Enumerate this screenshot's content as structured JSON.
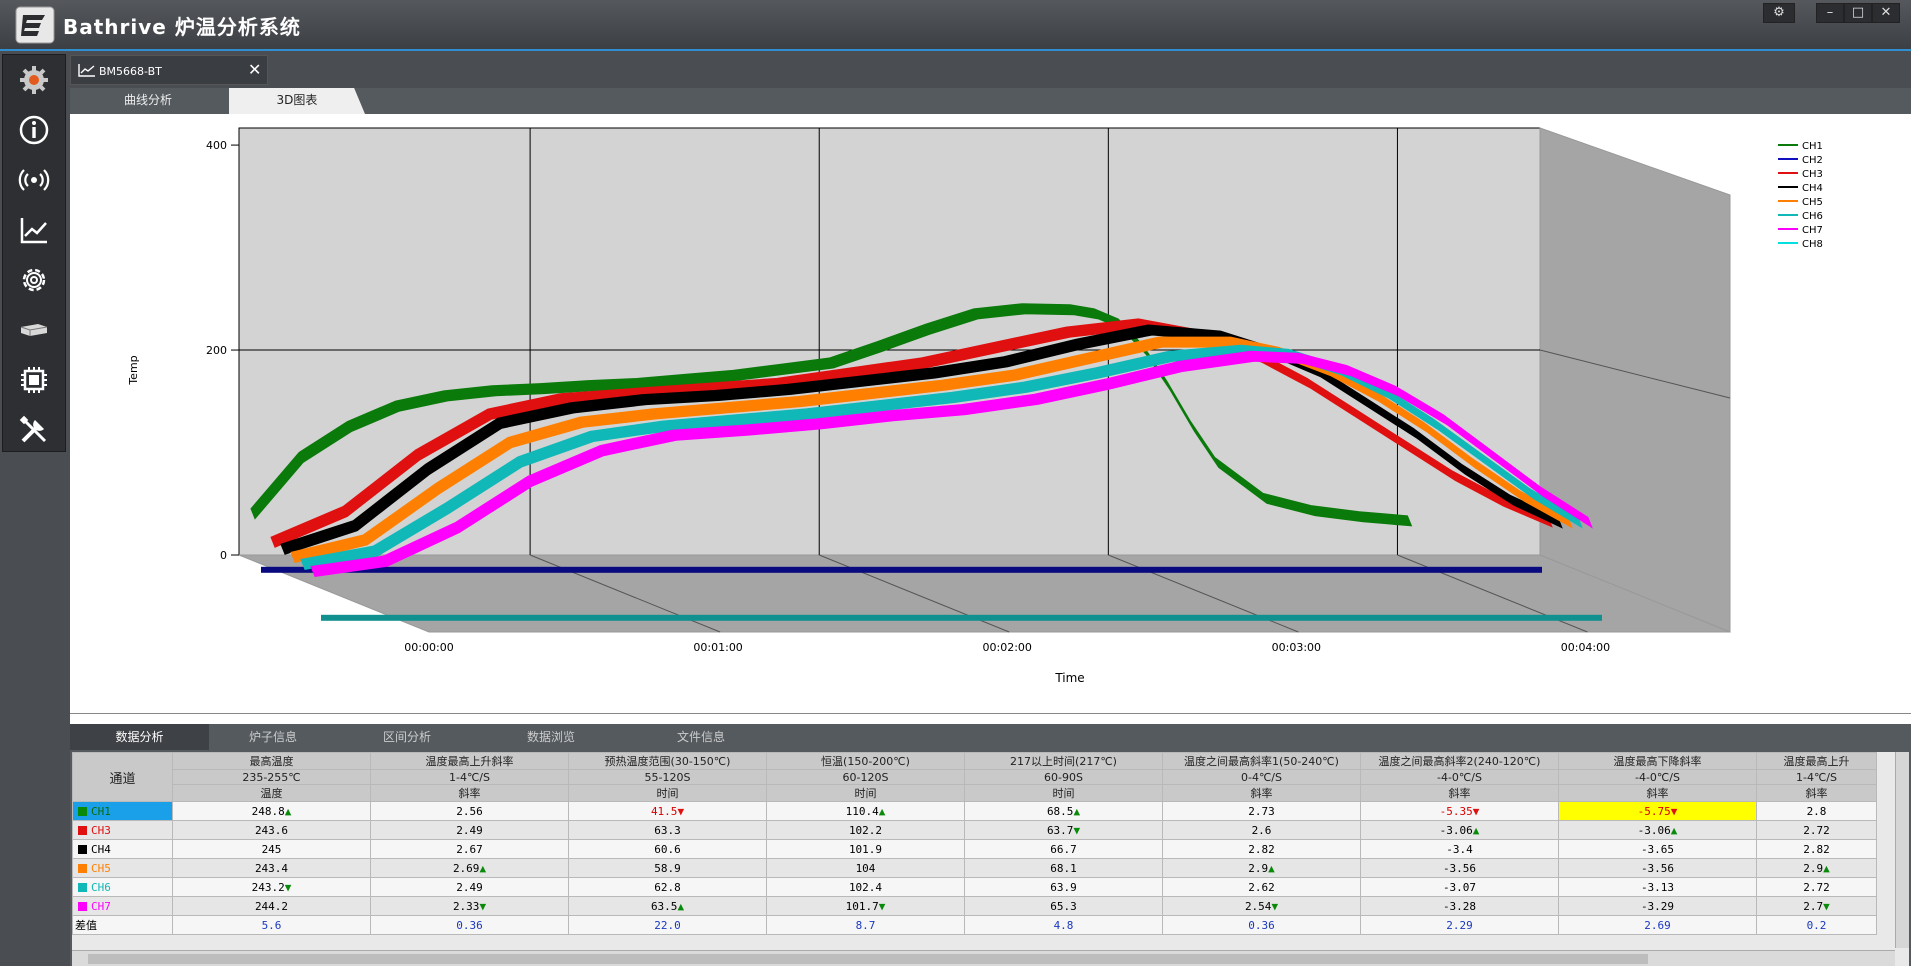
{
  "app": {
    "title": "Bathrive 炉温分析系统"
  },
  "window_controls": {
    "settings": "⚙",
    "minimize": "–",
    "maximize": "□",
    "close": "✕"
  },
  "sidebar": {
    "items": [
      {
        "name": "gear-logo-icon"
      },
      {
        "name": "info-icon"
      },
      {
        "name": "wireless-icon"
      },
      {
        "name": "line-chart-icon"
      },
      {
        "name": "settings-icon"
      },
      {
        "name": "device-icon"
      },
      {
        "name": "chip-icon"
      },
      {
        "name": "tools-icon"
      }
    ]
  },
  "doc_tab": {
    "label": "BM5668-BT",
    "close": "✕"
  },
  "view_tabs": {
    "curve": "曲线分析",
    "three_d": "3D图表"
  },
  "chart_data": {
    "type": "line",
    "style": "3d-ribbon",
    "ylabel": "Temp",
    "xlabel": "Time",
    "y_ticks": [
      "0",
      "200",
      "400"
    ],
    "ylim": [
      0,
      400
    ],
    "x_ticks": [
      "00:00:00",
      "00:01:00",
      "00:02:00",
      "00:03:00",
      "00:04:00"
    ],
    "xlim_seconds": [
      0,
      270
    ],
    "legend": [
      "CH1",
      "CH2",
      "CH3",
      "CH4",
      "CH5",
      "CH6",
      "CH7",
      "CH8"
    ],
    "legend_position": "top-right",
    "series": [
      {
        "name": "CH1",
        "color": "#0a7a0a",
        "x": [
          0,
          10,
          20,
          30,
          40,
          50,
          60,
          70,
          80,
          90,
          100,
          110,
          120,
          130,
          140,
          150,
          160,
          170,
          175,
          180,
          185,
          190,
          195,
          200,
          210,
          220,
          230,
          235,
          240
        ],
        "y": [
          45,
          100,
          130,
          150,
          160,
          165,
          167,
          170,
          172,
          176,
          180,
          186,
          192,
          208,
          225,
          240,
          245,
          244,
          240,
          230,
          205,
          170,
          130,
          95,
          60,
          48,
          42,
          40,
          38
        ]
      },
      {
        "name": "CH2",
        "color": "#1010c0",
        "x": [
          0,
          270
        ],
        "y": [
          0,
          0
        ]
      },
      {
        "name": "CH3",
        "color": "#e01010",
        "x": [
          0,
          15,
          30,
          45,
          60,
          75,
          90,
          105,
          120,
          135,
          150,
          165,
          180,
          195,
          205,
          215,
          225,
          235,
          245,
          255,
          265
        ],
        "y": [
          25,
          55,
          110,
          150,
          165,
          170,
          175,
          180,
          190,
          200,
          215,
          230,
          238,
          225,
          205,
          180,
          150,
          120,
          90,
          65,
          45
        ]
      },
      {
        "name": "CH4",
        "color": "#000000",
        "x": [
          0,
          15,
          30,
          45,
          60,
          75,
          90,
          105,
          120,
          135,
          150,
          165,
          180,
          195,
          205,
          215,
          225,
          235,
          245,
          255,
          265
        ],
        "y": [
          22,
          45,
          100,
          145,
          160,
          168,
          172,
          178,
          186,
          194,
          205,
          222,
          236,
          230,
          215,
          195,
          165,
          135,
          100,
          70,
          48
        ]
      },
      {
        "name": "CH5",
        "color": "#ff8000",
        "x": [
          0,
          15,
          30,
          45,
          60,
          75,
          90,
          105,
          120,
          135,
          150,
          165,
          180,
          195,
          205,
          215,
          225,
          235,
          245,
          255,
          265
        ],
        "y": [
          18,
          35,
          85,
          130,
          150,
          158,
          164,
          170,
          178,
          186,
          196,
          212,
          228,
          228,
          218,
          200,
          175,
          145,
          110,
          78,
          52
        ]
      },
      {
        "name": "CH6",
        "color": "#10b8b8",
        "x": [
          0,
          15,
          30,
          45,
          60,
          75,
          90,
          105,
          120,
          135,
          150,
          165,
          180,
          195,
          205,
          215,
          225,
          235,
          245,
          255,
          265
        ],
        "y": [
          15,
          28,
          70,
          115,
          140,
          150,
          156,
          162,
          170,
          178,
          188,
          202,
          218,
          224,
          220,
          205,
          182,
          152,
          118,
          84,
          56
        ]
      },
      {
        "name": "CH7",
        "color": "#ff00ff",
        "x": [
          0,
          15,
          30,
          45,
          60,
          75,
          90,
          105,
          120,
          135,
          150,
          165,
          180,
          195,
          205,
          215,
          225,
          235,
          245,
          255,
          265
        ],
        "y": [
          12,
          22,
          55,
          100,
          130,
          145,
          150,
          156,
          164,
          170,
          180,
          195,
          212,
          222,
          220,
          208,
          188,
          160,
          125,
          90,
          60
        ]
      },
      {
        "name": "CH8",
        "color": "#00e0e0",
        "x": [
          0,
          270
        ],
        "y": [
          0,
          0
        ]
      }
    ]
  },
  "bottom_tabs": [
    "数据分析",
    "炉子信息",
    "区间分析",
    "数据浏览",
    "文件信息"
  ],
  "table": {
    "channel_header": "通道",
    "columns": [
      {
        "title": "最高温度",
        "range": "235-255℃",
        "unit": "温度"
      },
      {
        "title": "温度最高上升斜率",
        "range": "1-4℃/S",
        "unit": "斜率"
      },
      {
        "title": "预热温度范围(30-150℃)",
        "range": "55-120S",
        "unit": "时间"
      },
      {
        "title": "恒温(150-200℃)",
        "range": "60-120S",
        "unit": "时间"
      },
      {
        "title": "217以上时间(217℃)",
        "range": "60-90S",
        "unit": "时间"
      },
      {
        "title": "温度之间最高斜率1(50-240℃)",
        "range": "0-4℃/S",
        "unit": "斜率"
      },
      {
        "title": "温度之间最高斜率2(240-120℃)",
        "range": "-4-0℃/S",
        "unit": "斜率"
      },
      {
        "title": "温度最高下降斜率",
        "range": "-4-0℃/S",
        "unit": "斜率"
      },
      {
        "title": "温度最高上升",
        "range": "1-4℃/S",
        "unit": "斜率"
      }
    ],
    "rows": [
      {
        "ch": "CH1",
        "color": "#0a8a0a",
        "cells": [
          {
            "v": "248.8",
            "m": "up"
          },
          {
            "v": "2.56"
          },
          {
            "v": "41.5",
            "m": "dn",
            "c": "red"
          },
          {
            "v": "110.4",
            "m": "up"
          },
          {
            "v": "68.5",
            "m": "up"
          },
          {
            "v": "2.73"
          },
          {
            "v": "-5.35",
            "m": "dn",
            "c": "red"
          },
          {
            "v": "-5.75",
            "m": "dn",
            "c": "red",
            "bg": "#ffff00"
          },
          {
            "v": "2.8"
          }
        ]
      },
      {
        "ch": "CH3",
        "color": "#e01010",
        "cells": [
          {
            "v": "243.6"
          },
          {
            "v": "2.49"
          },
          {
            "v": "63.3"
          },
          {
            "v": "102.2"
          },
          {
            "v": "63.7",
            "m": "dn2"
          },
          {
            "v": "2.6"
          },
          {
            "v": "-3.06",
            "m": "up"
          },
          {
            "v": "-3.06",
            "m": "up"
          },
          {
            "v": "2.72"
          }
        ]
      },
      {
        "ch": "CH4",
        "color": "#000000",
        "cells": [
          {
            "v": "245"
          },
          {
            "v": "2.67"
          },
          {
            "v": "60.6"
          },
          {
            "v": "101.9"
          },
          {
            "v": "66.7"
          },
          {
            "v": "2.82"
          },
          {
            "v": "-3.4"
          },
          {
            "v": "-3.65"
          },
          {
            "v": "2.82"
          }
        ]
      },
      {
        "ch": "CH5",
        "color": "#ff8000",
        "cells": [
          {
            "v": "243.4"
          },
          {
            "v": "2.69",
            "m": "up"
          },
          {
            "v": "58.9"
          },
          {
            "v": "104"
          },
          {
            "v": "68.1"
          },
          {
            "v": "2.9",
            "m": "up"
          },
          {
            "v": "-3.56"
          },
          {
            "v": "-3.56"
          },
          {
            "v": "2.9",
            "m": "up"
          }
        ]
      },
      {
        "ch": "CH6",
        "color": "#10b8b8",
        "cells": [
          {
            "v": "243.2",
            "m": "dn2"
          },
          {
            "v": "2.49"
          },
          {
            "v": "62.8"
          },
          {
            "v": "102.4"
          },
          {
            "v": "63.9"
          },
          {
            "v": "2.62"
          },
          {
            "v": "-3.07"
          },
          {
            "v": "-3.13"
          },
          {
            "v": "2.72"
          }
        ]
      },
      {
        "ch": "CH7",
        "color": "#ff00ff",
        "cells": [
          {
            "v": "244.2"
          },
          {
            "v": "2.33",
            "m": "dn2"
          },
          {
            "v": "63.5",
            "m": "up"
          },
          {
            "v": "101.7",
            "m": "dn2"
          },
          {
            "v": "65.3"
          },
          {
            "v": "2.54",
            "m": "dn2"
          },
          {
            "v": "-3.28"
          },
          {
            "v": "-3.29"
          },
          {
            "v": "2.7",
            "m": "dn2"
          }
        ]
      }
    ],
    "diff_label": "差值",
    "diff_values": [
      "5.6",
      "0.36",
      "22.0",
      "8.7",
      "4.8",
      "0.36",
      "2.29",
      "2.69",
      "0.2"
    ]
  }
}
